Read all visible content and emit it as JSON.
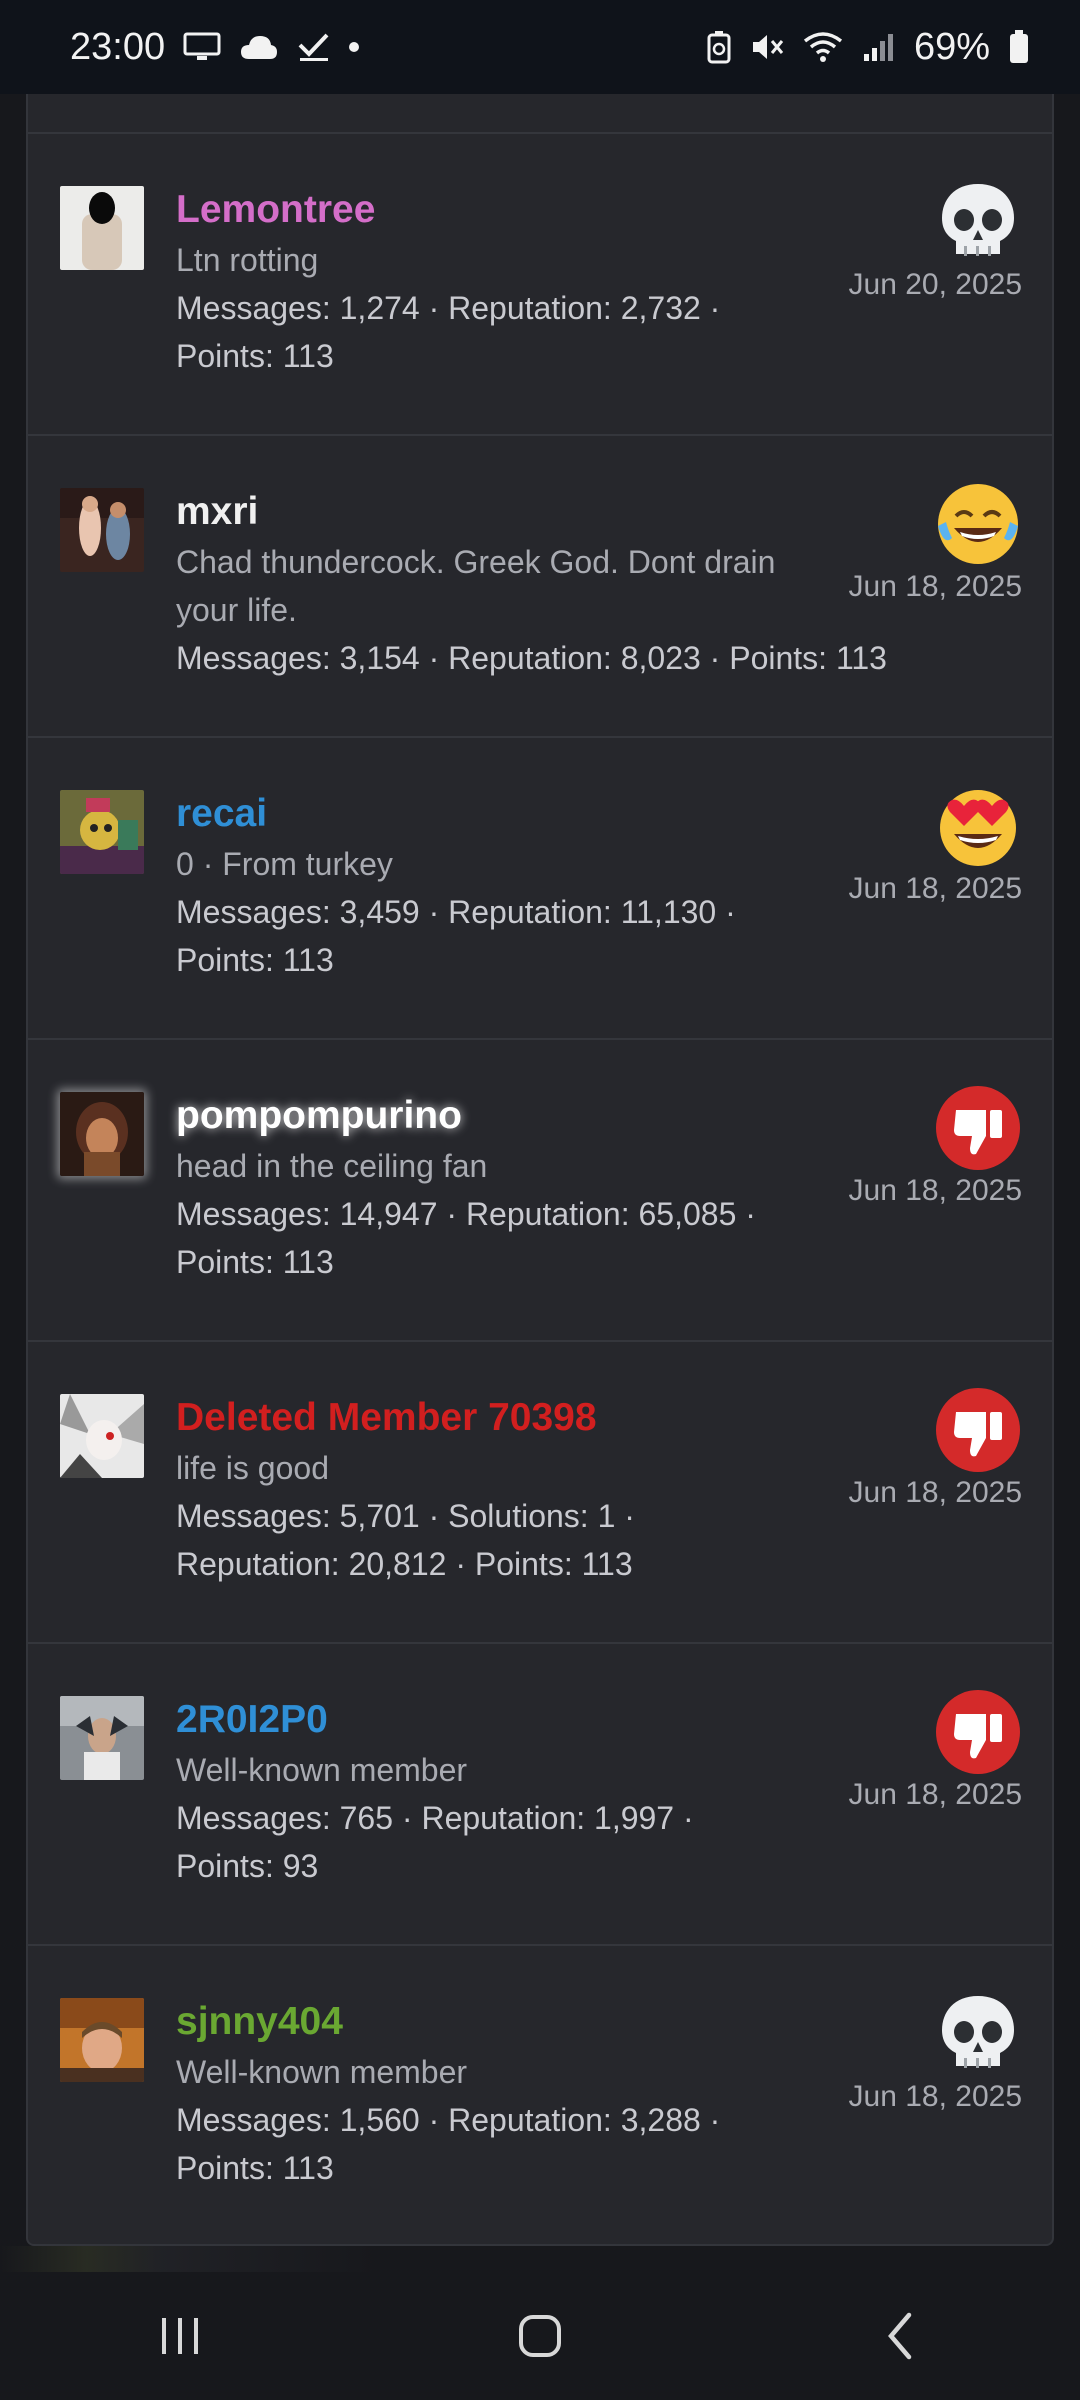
{
  "status_bar": {
    "time": "23:00",
    "battery": "69%",
    "left_icons": [
      "screen-icon",
      "cloud-icon",
      "check-icon",
      "dot-icon"
    ],
    "right_icons": [
      "battery-saver-icon",
      "mute-icon",
      "wifi-icon",
      "signal-icon",
      "battery-icon"
    ]
  },
  "colors": {
    "background": "#26272c",
    "lemontree": "#d46ec9",
    "mxri": "#f0f0f0",
    "recai": "#2f8fd6",
    "pompompurino": "#ffffff",
    "deleted": "#d21f1f",
    "r0i2p0": "#2f8fd6",
    "sjnny404": "#6aa832"
  },
  "members": [
    {
      "name": "Lemontree",
      "subtitle": "Ltn rotting",
      "stats_line1": "Messages: 1,274 · Reputation: 2,732 ·",
      "stats_line2": "Points: 113",
      "reaction": "skull-icon",
      "date": "Jun 20, 2025"
    },
    {
      "name": "mxri",
      "subtitle_line1": "Chad thundercock. Greek God. Dont drain",
      "subtitle_line2": "your life.",
      "stats_line1": "Messages: 3,154 · Reputation: 8,023 · Points: 113",
      "reaction": "laughing-tears-icon",
      "date": "Jun 18, 2025"
    },
    {
      "name": "recai",
      "subtitle": "0 · From turkey",
      "stats_line1": "Messages: 3,459 · Reputation: 11,130 ·",
      "stats_line2": "Points: 113",
      "reaction": "heart-eyes-icon",
      "date": "Jun 18, 2025"
    },
    {
      "name": "pompompurino",
      "subtitle": "head in the ceiling fan",
      "stats_line1": "Messages: 14,947 · Reputation: 65,085 ·",
      "stats_line2": "Points: 113",
      "reaction": "thumbs-down-icon",
      "date": "Jun 18, 2025"
    },
    {
      "name": "Deleted Member 70398",
      "subtitle": "life is good",
      "stats_line1": "Messages: 5,701 · Solutions: 1 ·",
      "stats_line2": "Reputation: 20,812 · Points: 113",
      "reaction": "thumbs-down-icon",
      "date": "Jun 18, 2025"
    },
    {
      "name": "2R0I2P0",
      "subtitle": "Well-known member",
      "stats_line1": "Messages: 765 · Reputation: 1,997 ·",
      "stats_line2": "Points: 93",
      "reaction": "thumbs-down-icon",
      "date": "Jun 18, 2025"
    },
    {
      "name": "sjnny404",
      "subtitle": "Well-known member",
      "stats_line1": "Messages: 1,560 · Reputation: 3,288 ·",
      "stats_line2": "Points: 113",
      "reaction": "skull-icon",
      "date": "Jun 18, 2025"
    }
  ],
  "nav_bar": {
    "buttons": [
      "recent-apps-icon",
      "home-icon",
      "back-icon"
    ]
  }
}
